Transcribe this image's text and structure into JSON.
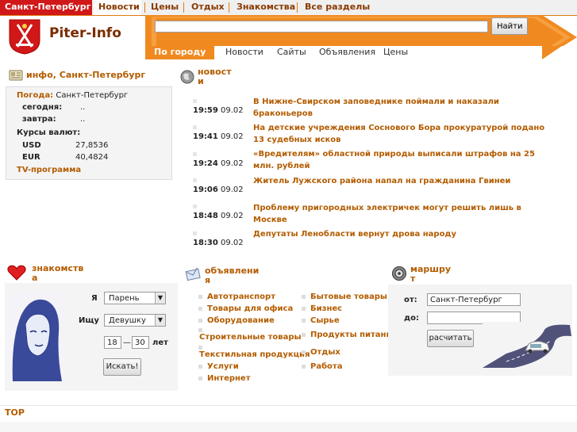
{
  "topnav": {
    "items": [
      "Санкт-Петербург",
      "Новости",
      "Цены",
      "Отдых",
      "Знакомства",
      "Все разделы"
    ]
  },
  "logo": {
    "text": "Piter-Info"
  },
  "search": {
    "value": "",
    "button": "Найти"
  },
  "subnav": {
    "items": [
      "По городу",
      "Новости",
      "Сайты",
      "Объявления",
      "Цены"
    ]
  },
  "info": {
    "title": "инфо, Санкт-Петербург",
    "weather_label": "Погода:",
    "weather_city": "Санкт-Петербург",
    "today_label": "сегодня:",
    "today_value": "..",
    "tomorrow_label": "завтра:",
    "tomorrow_value": "..",
    "rates_label": "Курсы валют:",
    "usd_label": "USD",
    "usd_value": "27,8536",
    "eur_label": "EUR",
    "eur_value": "40,4824",
    "tv_link": "TV-программа"
  },
  "news": {
    "title_line1": "новост",
    "title_line2": "и",
    "items": [
      {
        "time": "19:59",
        "date": "09.02",
        "text": "В Нижне-Свирском заповеднике поймали и наказали браконьеров"
      },
      {
        "time": "19:41",
        "date": "09.02",
        "text": "На детские учреждения Соснового Бора прокуратурой подано 13 судебных исков"
      },
      {
        "time": "19:24",
        "date": "09.02",
        "text": "«Вредителям» областной природы выписали штрафов на 25 млн. рублей"
      },
      {
        "time": "19:06",
        "date": "09.02",
        "text": "Житель Лужского района напал на гражданина Гвинеи"
      },
      {
        "time": "18:48",
        "date": "09.02",
        "text": "Проблему пригородных электричек могут решить лишь в Москве"
      },
      {
        "time": "18:30",
        "date": "09.02",
        "text": "Депутаты Ленобласти вернут дрова народу"
      }
    ]
  },
  "dating": {
    "title_line1": "знакомств",
    "title_line2": "а",
    "i_label": "Я",
    "i_value": "Парень",
    "seek_label": "Ищу",
    "seek_value": "Девушку",
    "age_from": "18",
    "age_dash": "—",
    "age_to": "30",
    "age_unit": "лет",
    "search_button": "Искать!"
  },
  "ads": {
    "title_line1": "объявлени",
    "title_line2": "я",
    "col1": [
      "Автотранспорт",
      "Товары для офиса",
      "Оборудование",
      "Строительные товары",
      "Текстильная продукция",
      "Услуги",
      "Интернет"
    ],
    "col2": [
      "Бытовые товары",
      "Бизнес",
      "Сырье",
      "Продукты питания",
      "Отдых",
      "Работа"
    ]
  },
  "route": {
    "title_line1": "маршру",
    "title_line2": "т",
    "from_label": "от:",
    "from_value": "Санкт-Петербург",
    "to_label": "до:",
    "to_value": "",
    "button": "расчитать"
  },
  "footer": {
    "top_label": "TOP"
  },
  "colors": {
    "accent": "#f08a20",
    "link": "#b35c00",
    "brand_red": "#d01818"
  }
}
